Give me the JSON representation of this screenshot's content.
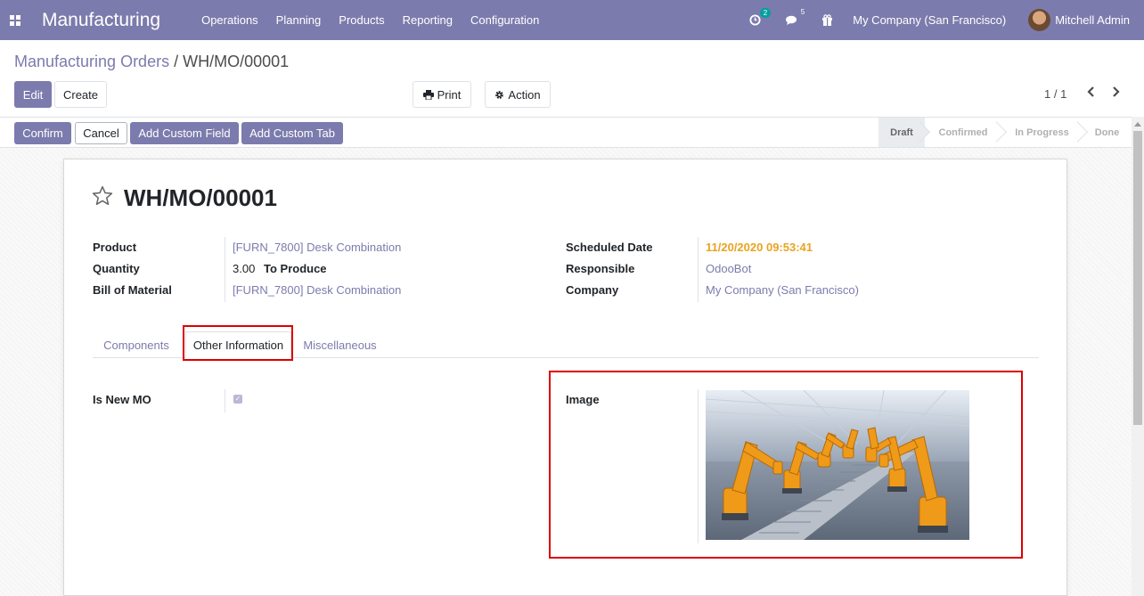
{
  "navbar": {
    "brand": "Manufacturing",
    "menu": [
      "Operations",
      "Planning",
      "Products",
      "Reporting",
      "Configuration"
    ],
    "activity_badge": "2",
    "messages_badge": "5",
    "company": "My Company (San Francisco)",
    "user": "Mitchell Admin"
  },
  "breadcrumb": {
    "parent": "Manufacturing Orders",
    "separator": "/",
    "current": "WH/MO/00001"
  },
  "control": {
    "edit": "Edit",
    "create": "Create",
    "print": "Print",
    "action": "Action",
    "pager": "1 / 1"
  },
  "statusbar": {
    "buttons": [
      "Confirm",
      "Cancel",
      "Add Custom Field",
      "Add Custom Tab"
    ],
    "stages": [
      "Draft",
      "Confirmed",
      "In Progress",
      "Done"
    ],
    "active_stage": "Draft"
  },
  "record": {
    "title": "WH/MO/00001",
    "left_fields": [
      {
        "label": "Product",
        "value": "[FURN_7800] Desk Combination"
      },
      {
        "label": "Quantity",
        "value": "3.00",
        "suffix": "To Produce"
      },
      {
        "label": "Bill of Material",
        "value": "[FURN_7800] Desk Combination"
      }
    ],
    "right_fields": [
      {
        "label": "Scheduled Date",
        "value": "11/20/2020 09:53:41"
      },
      {
        "label": "Responsible",
        "value": "OdooBot"
      },
      {
        "label": "Company",
        "value": "My Company (San Francisco)"
      }
    ]
  },
  "tabs": [
    "Components",
    "Other Information",
    "Miscellaneous"
  ],
  "other_info": {
    "is_new_mo_label": "Is New MO",
    "is_new_mo": true,
    "image_label": "Image"
  },
  "colors": {
    "brand": "#7c7bad",
    "warning_date": "#e9a420",
    "highlight": "#dd0000"
  }
}
